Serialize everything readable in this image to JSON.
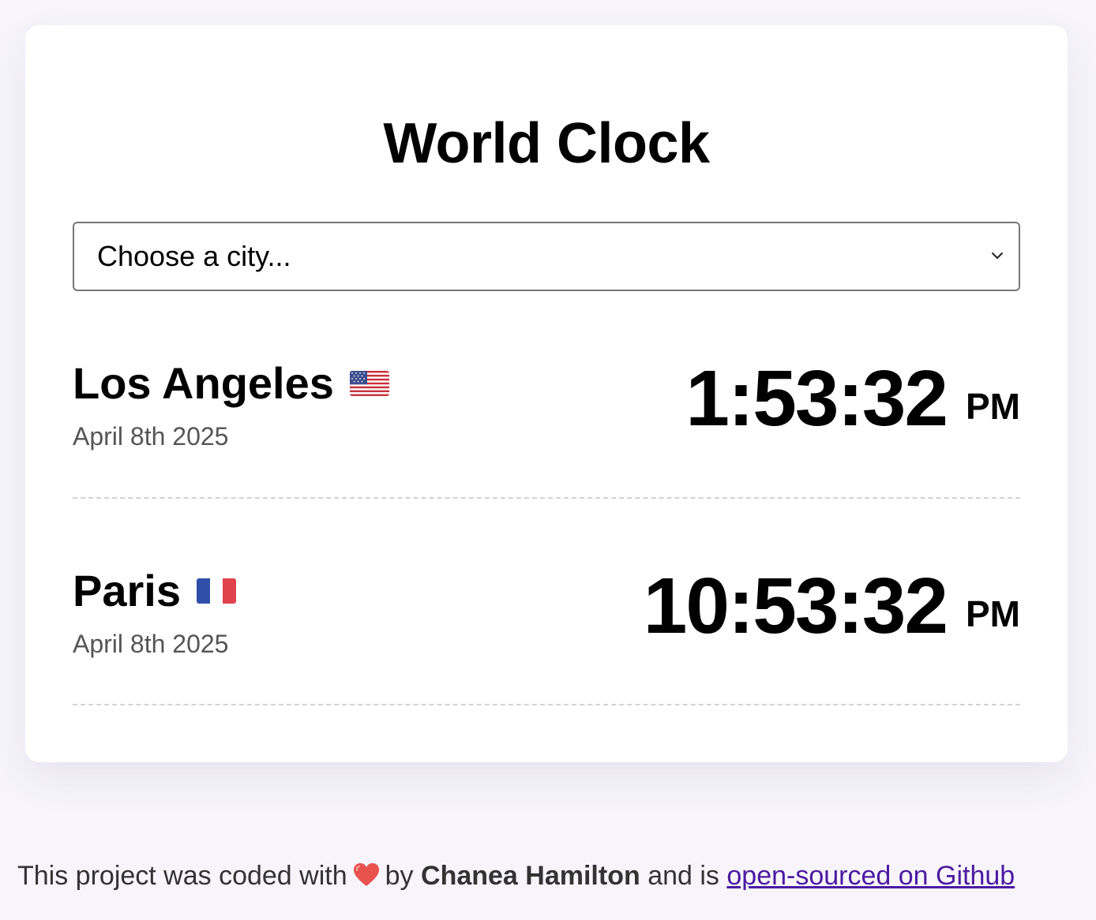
{
  "header": {
    "title": "World Clock"
  },
  "city_select": {
    "selected": "Choose a city..."
  },
  "cities": [
    {
      "name": "Los Angeles",
      "flag": "us-flag-icon",
      "date": "April 8th 2025",
      "time": "1:53:32",
      "ampm": "PM"
    },
    {
      "name": "Paris",
      "flag": "france-flag-icon",
      "date": "April 8th 2025",
      "time": "10:53:32",
      "ampm": "PM"
    }
  ],
  "footer": {
    "text_before": "This project was coded with",
    "heart_icon": "heart-icon",
    "text_by": "by",
    "author": "Chanea Hamilton",
    "text_and": "and is",
    "link_text": "open-sourced on Github"
  },
  "colors": {
    "page_background": "#f7f5fb",
    "card_background": "#ffffff",
    "date_text": "#555555",
    "link": "#4b1aa2",
    "heart": "#e8524f",
    "divider": "#d3d3d3"
  }
}
